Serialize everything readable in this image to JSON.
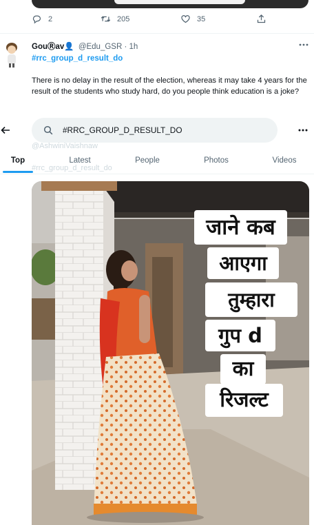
{
  "previous_tweet": {
    "reply_count": "2",
    "retweet_count": "205",
    "like_count": "35"
  },
  "tweet": {
    "name": "GouⓇav👤",
    "handle": "@Edu_GSR · 1h",
    "hashtag": "#rrc_group_d_result_do",
    "text": "There is no delay in the result of the election, whereas it may take 4 years for the result of the students who study hard, do you people think education is a joke?",
    "image_overlay_lines": [
      "जाने कब",
      "आएगा",
      "तुम्हारा",
      "गुप d",
      "का",
      "रिजल्ट"
    ]
  },
  "search": {
    "query": "#RRC_GROUP_D_RESULT_DO",
    "ghost_mention": "@AshwiniVaishnaw",
    "ghost_hashtag": "#rrc_group_d_result_do"
  },
  "tabs": [
    {
      "label": "Top",
      "active": true
    },
    {
      "label": "Latest",
      "active": false
    },
    {
      "label": "People",
      "active": false
    },
    {
      "label": "Photos",
      "active": false
    },
    {
      "label": "Videos",
      "active": false
    }
  ],
  "colors": {
    "accent": "#1d9bf0",
    "text_primary": "#0f1419",
    "text_secondary": "#536471",
    "search_bg": "#eff3f4"
  },
  "icons": [
    "reply-icon",
    "retweet-icon",
    "like-icon",
    "share-icon",
    "more-icon",
    "back-arrow-icon",
    "search-icon"
  ]
}
